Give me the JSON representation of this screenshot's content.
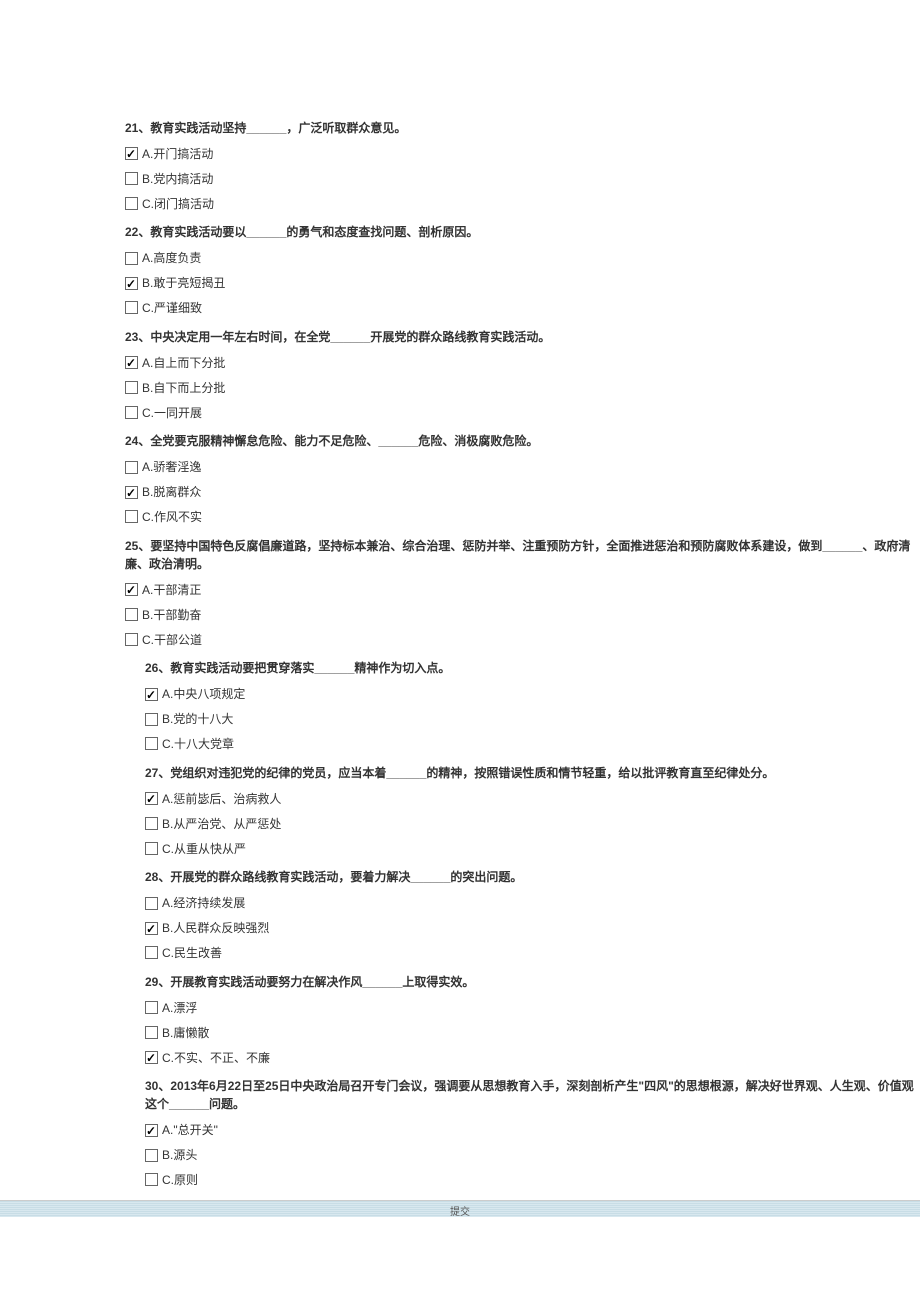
{
  "questions": [
    {
      "number": "21",
      "text": "21、教育实践活动坚持______，广泛听取群众意见。",
      "indented": false,
      "options": [
        {
          "label": "A.开门搞活动",
          "checked": true
        },
        {
          "label": "B.党内搞活动",
          "checked": false
        },
        {
          "label": "C.闭门搞活动",
          "checked": false
        }
      ]
    },
    {
      "number": "22",
      "text": "22、教育实践活动要以______的勇气和态度查找问题、剖析原因。",
      "indented": false,
      "options": [
        {
          "label": "A.高度负责",
          "checked": false
        },
        {
          "label": "B.敢于亮短揭丑",
          "checked": true
        },
        {
          "label": "C.严谨细致",
          "checked": false
        }
      ]
    },
    {
      "number": "23",
      "text": "23、中央决定用一年左右时间，在全党______开展党的群众路线教育实践活动。",
      "indented": false,
      "options": [
        {
          "label": "A.自上而下分批",
          "checked": true
        },
        {
          "label": "B.自下而上分批",
          "checked": false
        },
        {
          "label": "C.一同开展",
          "checked": false
        }
      ]
    },
    {
      "number": "24",
      "text": "24、全党要克服精神懈怠危险、能力不足危险、______危险、消极腐败危险。",
      "indented": false,
      "options": [
        {
          "label": "A.骄奢淫逸",
          "checked": false
        },
        {
          "label": "B.脱离群众",
          "checked": true
        },
        {
          "label": "C.作风不实",
          "checked": false
        }
      ]
    },
    {
      "number": "25",
      "text": "25、要坚持中国特色反腐倡廉道路，坚持标本兼治、综合治理、惩防并举、注重预防方针，全面推进惩治和预防腐败体系建设，做到______、政府清廉、政治清明。",
      "indented": false,
      "options": [
        {
          "label": "A.干部清正",
          "checked": true
        },
        {
          "label": "B.干部勤奋",
          "checked": false
        },
        {
          "label": "C.干部公道",
          "checked": false
        }
      ]
    },
    {
      "number": "26",
      "text": "26、教育实践活动要把贯穿落实______精神作为切入点。",
      "indented": true,
      "options": [
        {
          "label": "A.中央八项规定",
          "checked": true
        },
        {
          "label": "B.党的十八大",
          "checked": false
        },
        {
          "label": "C.十八大党章",
          "checked": false
        }
      ]
    },
    {
      "number": "27",
      "text": "27、党组织对违犯党的纪律的党员，应当本着______的精神，按照错误性质和情节轻重，给以批评教育直至纪律处分。",
      "indented": true,
      "options": [
        {
          "label": "A.惩前毖后、治病救人",
          "checked": true
        },
        {
          "label": "B.从严治党、从严惩处",
          "checked": false
        },
        {
          "label": "C.从重从快从严",
          "checked": false
        }
      ]
    },
    {
      "number": "28",
      "text": "28、开展党的群众路线教育实践活动，要着力解决______的突出问题。",
      "indented": true,
      "options": [
        {
          "label": "A.经济持续发展",
          "checked": false
        },
        {
          "label": "B.人民群众反映强烈",
          "checked": true
        },
        {
          "label": "C.民生改善",
          "checked": false
        }
      ]
    },
    {
      "number": "29",
      "text": "29、开展教育实践活动要努力在解决作风______上取得实效。",
      "indented": true,
      "options": [
        {
          "label": "A.漂浮",
          "checked": false
        },
        {
          "label": "B.庸懒散",
          "checked": false
        },
        {
          "label": "C.不实、不正、不廉",
          "checked": true
        }
      ]
    },
    {
      "number": "30",
      "text": "30、2013年6月22日至25日中央政治局召开专门会议，强调要从思想教育入手，深刻剖析产生\"四风\"的思想根源，解决好世界观、人生观、价值观这个______问题。",
      "indented": true,
      "options": [
        {
          "label": "A.\"总开关\"",
          "checked": true
        },
        {
          "label": "B.源头",
          "checked": false
        },
        {
          "label": "C.原则",
          "checked": false
        }
      ]
    }
  ],
  "submit_label": "提交"
}
